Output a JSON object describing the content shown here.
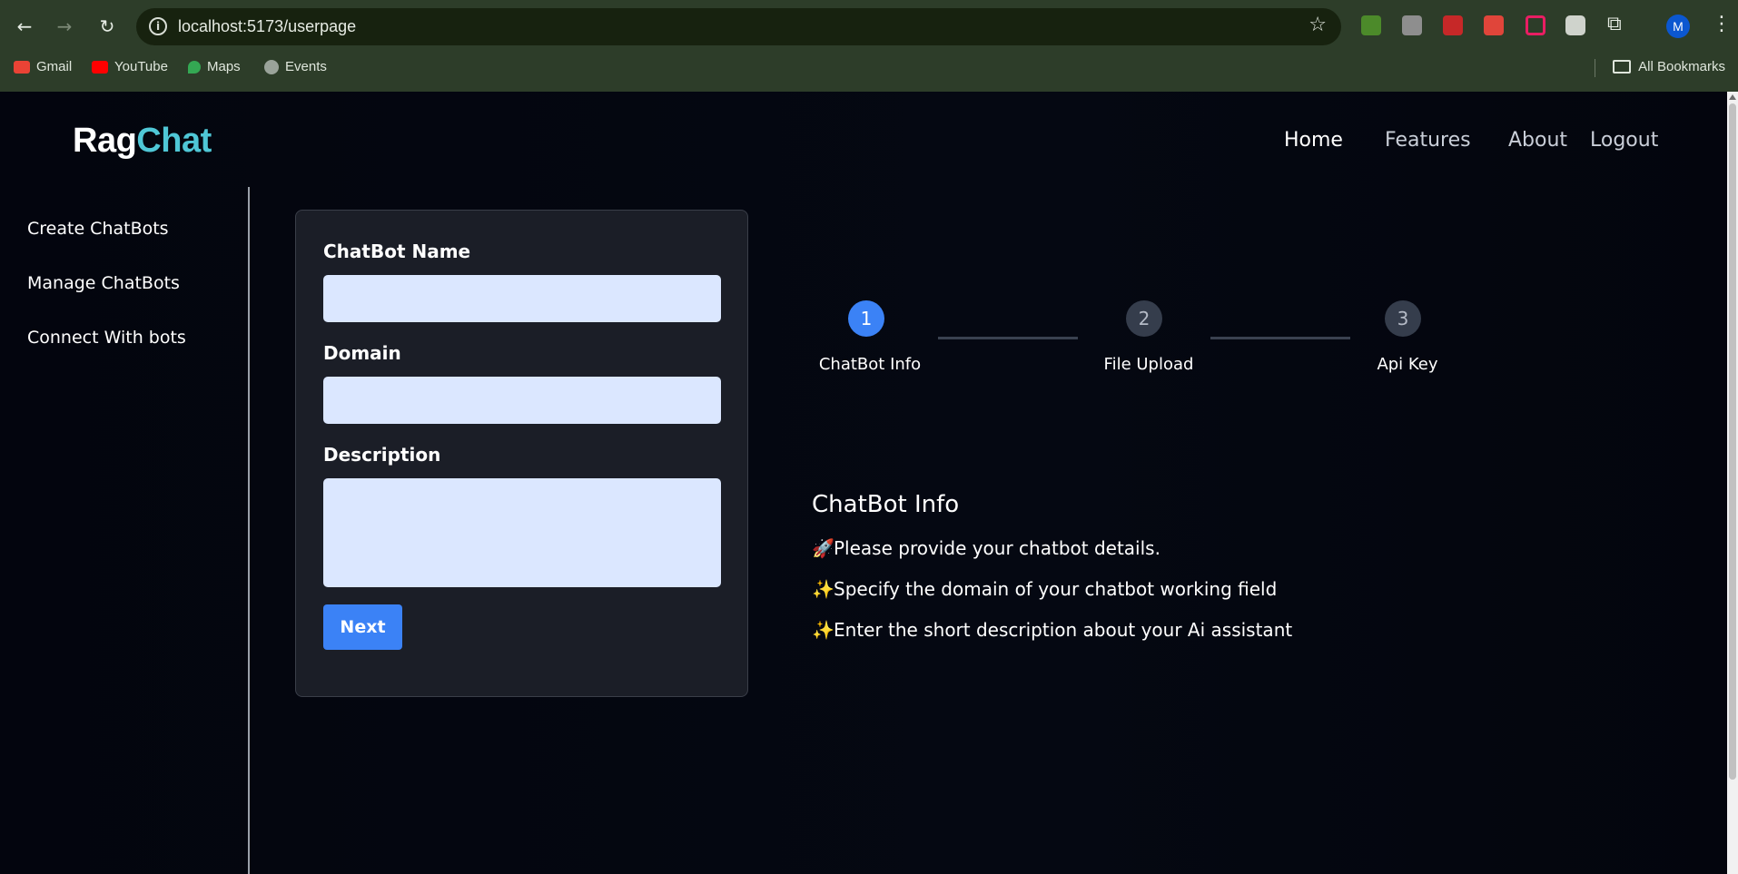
{
  "browser": {
    "url": "localhost:5173/userpage",
    "avatar_letter": "M",
    "bookmarks": [
      {
        "label": "Gmail",
        "color": "#ea4335"
      },
      {
        "label": "YouTube",
        "color": "#ff0000"
      },
      {
        "label": "Maps",
        "color": "#34a853"
      },
      {
        "label": "Events",
        "color": "#9aa39a"
      }
    ],
    "all_bookmarks": "All Bookmarks"
  },
  "brand": {
    "part1": "Rag",
    "part2": "Chat",
    "accent_color": "#4fc7d6"
  },
  "topnav": {
    "home": "Home",
    "features": "Features",
    "about": "About",
    "logout": "Logout"
  },
  "sidebar": {
    "items": [
      "Create ChatBots",
      "Manage ChatBots",
      "Connect With bots"
    ]
  },
  "form": {
    "name_label": "ChatBot Name",
    "name_value": "",
    "domain_label": "Domain",
    "domain_value": "",
    "description_label": "Description",
    "description_value": "",
    "next_label": "Next"
  },
  "stepper": {
    "steps": [
      {
        "number": "1",
        "label": "ChatBot Info",
        "active": true
      },
      {
        "number": "2",
        "label": "File Upload",
        "active": false
      },
      {
        "number": "3",
        "label": "Api Key",
        "active": false
      }
    ]
  },
  "info": {
    "title": "ChatBot Info",
    "lines": [
      {
        "emoji": "🚀",
        "text": "Please provide your chatbot details."
      },
      {
        "emoji": "✨",
        "text": "Specify the domain of your chatbot working field"
      },
      {
        "emoji": "✨",
        "text": "Enter the short description about your Ai assistant"
      }
    ]
  },
  "colors": {
    "primary": "#3b82f6",
    "input_bg": "#dbe7ff",
    "card_bg": "#1b1e27"
  }
}
